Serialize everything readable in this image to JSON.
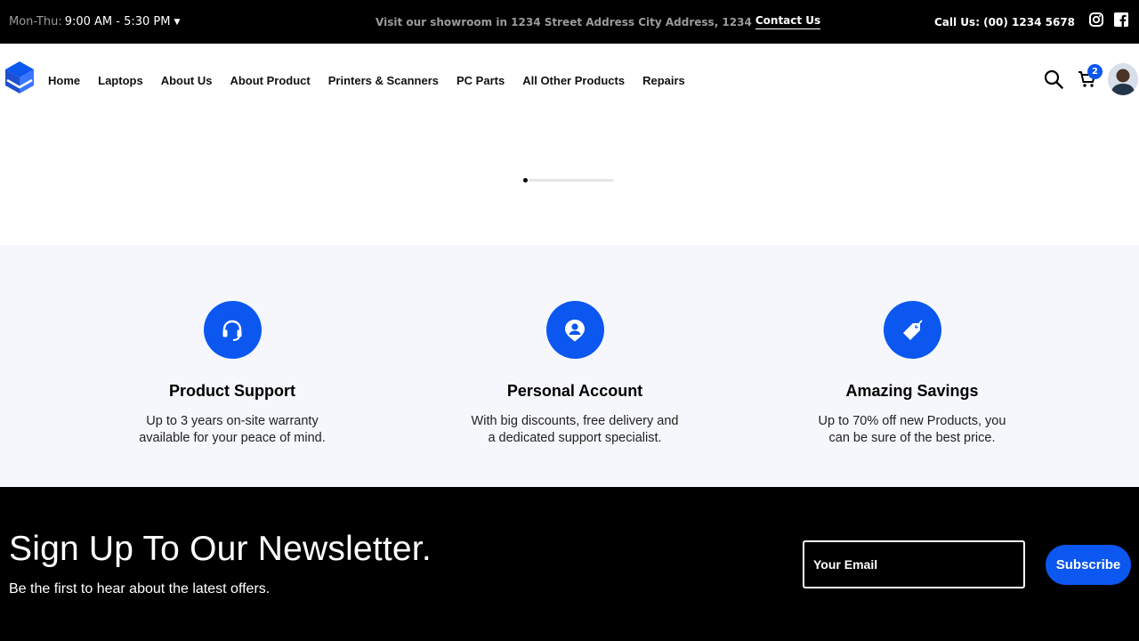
{
  "colors": {
    "accent": "#0b57f0",
    "topbar_bg": "#000000",
    "features_bg": "#f5f7fc"
  },
  "topbar": {
    "hours_days": "Mon-Thu:",
    "hours_time": "9:00 AM - 5:30 PM",
    "showroom_text": "Visit our showroom in 1234 Street Address City Address, 1234",
    "contact_label": "Contact Us",
    "call_text": "Call Us: (00) 1234 5678",
    "social_icons": [
      "instagram-icon",
      "facebook-icon"
    ]
  },
  "nav": {
    "items": [
      {
        "label": "Home"
      },
      {
        "label": "Laptops"
      },
      {
        "label": "About Us"
      },
      {
        "label": "About Product"
      },
      {
        "label": "Printers & Scanners"
      },
      {
        "label": "PC Parts"
      },
      {
        "label": "All Other Products"
      },
      {
        "label": "Repairs"
      }
    ],
    "cart_count": "2"
  },
  "slider": {
    "active_index": 0,
    "progress": 0.05
  },
  "features": [
    {
      "icon": "headset-icon",
      "title": "Product Support",
      "line1": "Up to 3 years on-site warranty",
      "line2": "available for your peace of mind."
    },
    {
      "icon": "user-icon",
      "title": "Personal Account",
      "line1": "With big discounts, free delivery and",
      "line2": "a dedicated support specialist."
    },
    {
      "icon": "tag-icon",
      "title": "Amazing Savings",
      "line1": "Up to 70% off new Products, you",
      "line2": "can be sure of the best price."
    }
  ],
  "newsletter": {
    "title": "Sign Up To Our Newsletter.",
    "subtitle": "Be the first to hear about the latest offers.",
    "email_placeholder": "Your Email",
    "button_label": "Subscribe"
  }
}
